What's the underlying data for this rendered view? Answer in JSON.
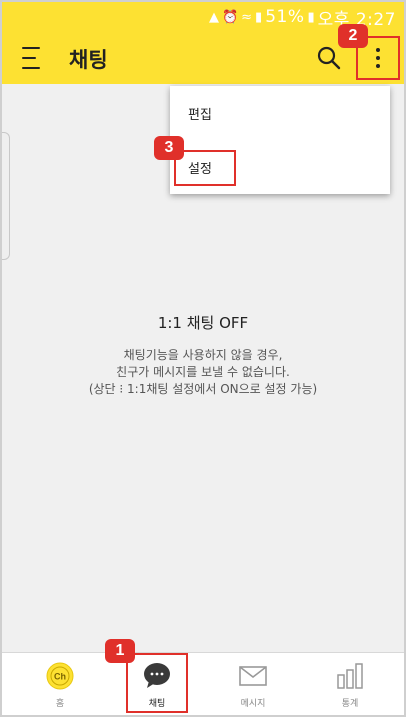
{
  "status_bar": {
    "battery": "51%",
    "time": "오후 2:27"
  },
  "app_bar": {
    "title": "채팅"
  },
  "dropdown": {
    "items": [
      {
        "label": "편집"
      },
      {
        "label": "설정"
      }
    ]
  },
  "empty_state": {
    "title": "1:1 채팅 OFF",
    "lines": [
      "채팅기능을 사용하지 않을 경우,",
      "친구가 메시지를 보낼 수 없습니다.",
      "(상단 ⁝ 1:1채팅 설정에서 ON으로 설정 가능)"
    ]
  },
  "badges": {
    "b1": "1",
    "b2": "2",
    "b3": "3"
  },
  "bottom_nav": {
    "items": [
      {
        "label": "홈",
        "icon": "ch-logo-icon"
      },
      {
        "label": "채팅",
        "icon": "chat-bubble-icon"
      },
      {
        "label": "메시지",
        "icon": "envelope-icon"
      },
      {
        "label": "통계",
        "icon": "bar-chart-icon"
      }
    ],
    "home_logo_text": "Ch"
  },
  "colors": {
    "brand_yellow": "#fde132",
    "highlight_red": "#e0302a"
  }
}
